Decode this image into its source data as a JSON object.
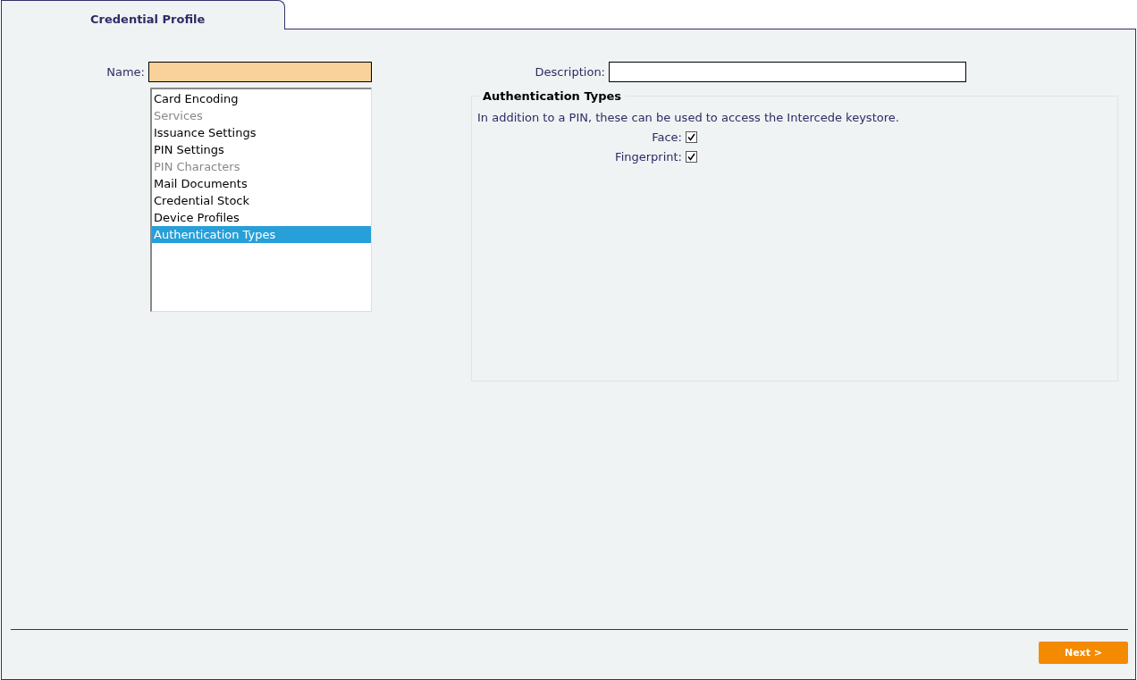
{
  "tabs": [
    {
      "label": "Credential Profile",
      "selected": true
    }
  ],
  "name_field": {
    "label": "Name:"
  },
  "sections": [
    {
      "label": "Card Encoding",
      "disabled": false,
      "selected": false
    },
    {
      "label": "Services",
      "disabled": true,
      "selected": false
    },
    {
      "label": "Issuance Settings",
      "disabled": false,
      "selected": false
    },
    {
      "label": "PIN Settings",
      "disabled": false,
      "selected": false
    },
    {
      "label": "PIN Characters",
      "disabled": true,
      "selected": false
    },
    {
      "label": "Mail Documents",
      "disabled": false,
      "selected": false
    },
    {
      "label": "Credential Stock",
      "disabled": false,
      "selected": false
    },
    {
      "label": "Device Profiles",
      "disabled": false,
      "selected": false
    },
    {
      "label": "Authentication Types",
      "disabled": false,
      "selected": true
    }
  ],
  "description_field": {
    "label": "Description:"
  },
  "group": {
    "title": "Authentication Types",
    "text": "In addition to a PIN, these can be used to access the Intercede keystore.",
    "options": [
      {
        "label": "Face:",
        "checked": true
      },
      {
        "label": "Fingerprint:",
        "checked": true
      }
    ]
  },
  "buttons": [
    {
      "label": "Next >"
    }
  ]
}
